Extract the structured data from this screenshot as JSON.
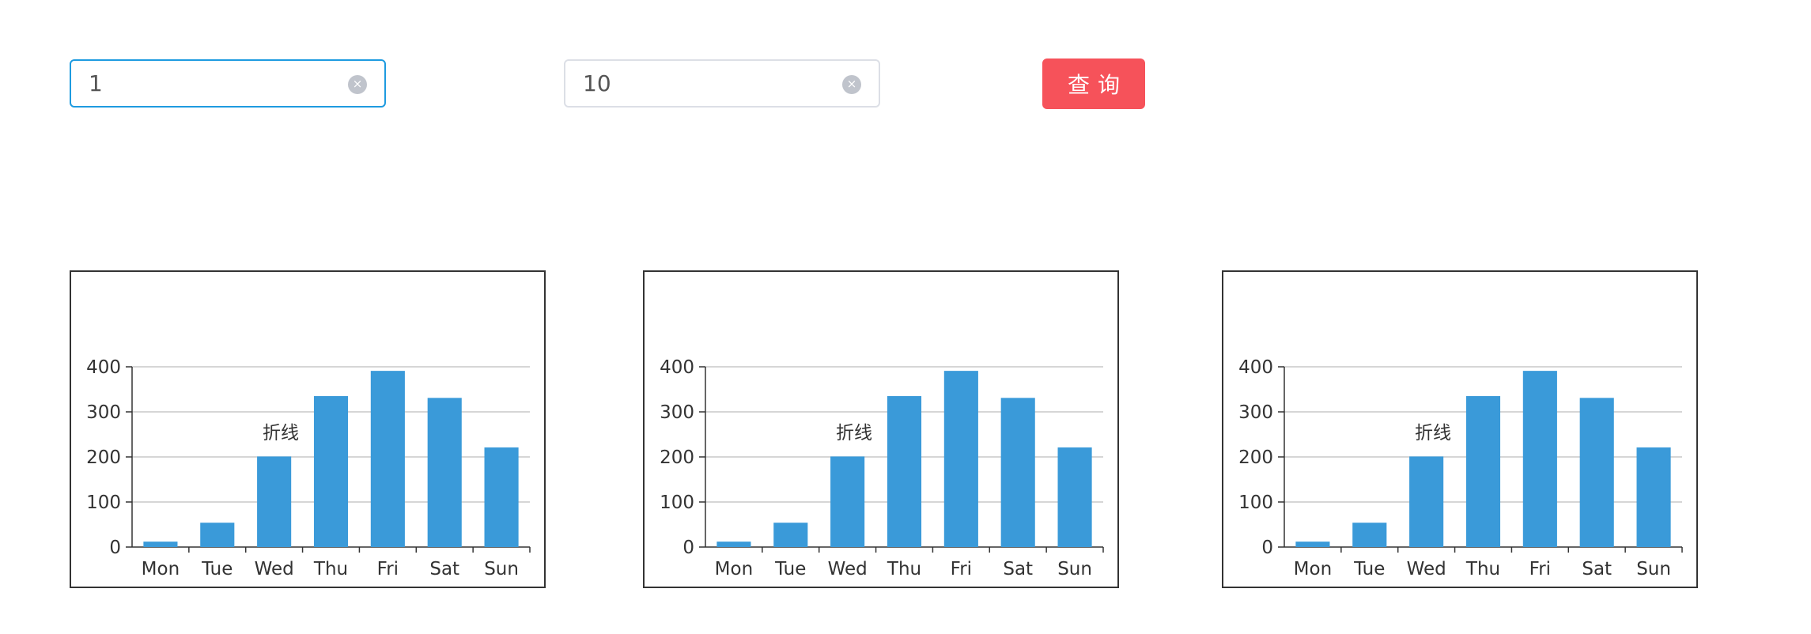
{
  "query": {
    "start_value": "1",
    "end_value": "10",
    "clear_icon": "×",
    "button_label": "查询"
  },
  "colors": {
    "accent": "#1e9be0",
    "button": "#f6525a",
    "bar": "#3a9ad9"
  },
  "chart_data": [
    {
      "type": "bar",
      "categories": [
        "Mon",
        "Tue",
        "Wed",
        "Thu",
        "Fri",
        "Sat",
        "Sun"
      ],
      "values": [
        12,
        54,
        201,
        335,
        391,
        331,
        221
      ],
      "ylim": [
        0,
        400
      ],
      "yticks": [
        0,
        100,
        200,
        300,
        400
      ],
      "overlay_text": "折线",
      "grid": true
    },
    {
      "type": "bar",
      "categories": [
        "Mon",
        "Tue",
        "Wed",
        "Thu",
        "Fri",
        "Sat",
        "Sun"
      ],
      "values": [
        12,
        54,
        201,
        335,
        391,
        331,
        221
      ],
      "ylim": [
        0,
        400
      ],
      "yticks": [
        0,
        100,
        200,
        300,
        400
      ],
      "overlay_text": "折线",
      "grid": true
    },
    {
      "type": "bar",
      "categories": [
        "Mon",
        "Tue",
        "Wed",
        "Thu",
        "Fri",
        "Sat",
        "Sun"
      ],
      "values": [
        12,
        54,
        201,
        335,
        391,
        331,
        221
      ],
      "ylim": [
        0,
        400
      ],
      "yticks": [
        0,
        100,
        200,
        300,
        400
      ],
      "overlay_text": "折线",
      "grid": true
    }
  ]
}
